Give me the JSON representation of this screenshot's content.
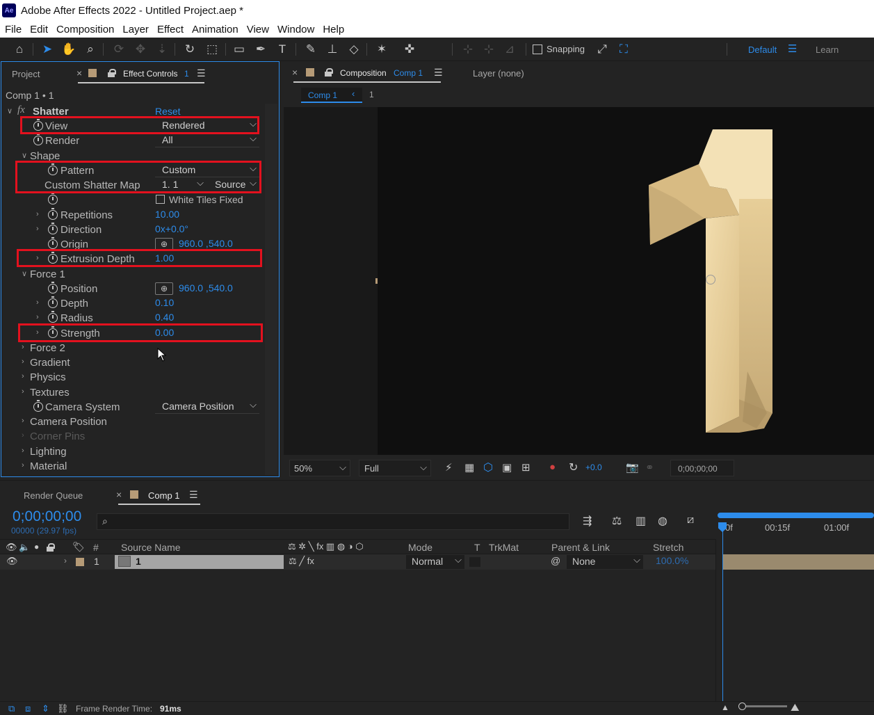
{
  "titlebar": {
    "app_icon": "Ae",
    "title": "Adobe After Effects 2022 - Untitled Project.aep *"
  },
  "menubar": [
    "File",
    "Edit",
    "Composition",
    "Layer",
    "Effect",
    "Animation",
    "View",
    "Window",
    "Help"
  ],
  "toolbar": {
    "snapping_label": "Snapping",
    "workspace": "Default",
    "learn": "Learn"
  },
  "left_panel": {
    "tab_project": "Project",
    "tab_effect_controls": "Effect Controls",
    "tab_effect_controls_count": "1",
    "breadcrumb": "Comp 1 • 1",
    "effect_name": "Shatter",
    "reset": "Reset",
    "rows": {
      "view_label": "View",
      "view_value": "Rendered",
      "render_label": "Render",
      "render_value": "All",
      "shape_label": "Shape",
      "pattern_label": "Pattern",
      "pattern_value": "Custom",
      "custom_map_label": "Custom Shatter Map",
      "custom_map_value": "1. 1",
      "custom_map_source": "Source",
      "white_tiles_label": "White Tiles Fixed",
      "repetitions_label": "Repetitions",
      "repetitions_value": "10.00",
      "direction_label": "Direction",
      "direction_value": "0x+0.0°",
      "origin_label": "Origin",
      "origin_value": "960.0 ,540.0",
      "extrusion_label": "Extrusion Depth",
      "extrusion_value": "1.00",
      "force1_label": "Force 1",
      "position_label": "Position",
      "position_value": "960.0 ,540.0",
      "depth_label": "Depth",
      "depth_value": "0.10",
      "radius_label": "Radius",
      "radius_value": "0.40",
      "strength_label": "Strength",
      "strength_value": "0.00",
      "force2_label": "Force 2",
      "gradient_label": "Gradient",
      "physics_label": "Physics",
      "textures_label": "Textures",
      "camera_system_label": "Camera System",
      "camera_system_value": "Camera Position",
      "camera_position_label": "Camera Position",
      "corner_pins_label": "Corner Pins",
      "lighting_label": "Lighting",
      "material_label": "Material"
    }
  },
  "comp_panel": {
    "tab_label": "Composition",
    "tab_comp": "Comp 1",
    "layer_tab": "Layer (none)",
    "sub_tab": "Comp 1",
    "sub_tab_index": "1",
    "zoom": "50%",
    "resolution": "Full",
    "exposure": "+0.0",
    "timecode": "0;00;00;00"
  },
  "timeline": {
    "tab_render_queue": "Render Queue",
    "tab_comp": "Comp 1",
    "current_time": "0;00;00;00",
    "frame_info": "00000 (29.97 fps)",
    "search_placeholder": "",
    "columns": {
      "hash": "#",
      "source_name": "Source Name",
      "mode": "Mode",
      "t": "T",
      "trkmat": "TrkMat",
      "parent": "Parent & Link",
      "stretch": "Stretch"
    },
    "ruler": [
      "0f",
      "00:15f",
      "01:00f"
    ],
    "layer": {
      "index": "1",
      "name": "1",
      "mode": "Normal",
      "parent": "None",
      "stretch": "100.0%"
    }
  },
  "status": {
    "label": "Frame Render Time:",
    "value": "91ms"
  },
  "colors": {
    "accent": "#2d8ceb",
    "highlight_box": "#e3111e",
    "number_face": "#e8cf98"
  }
}
